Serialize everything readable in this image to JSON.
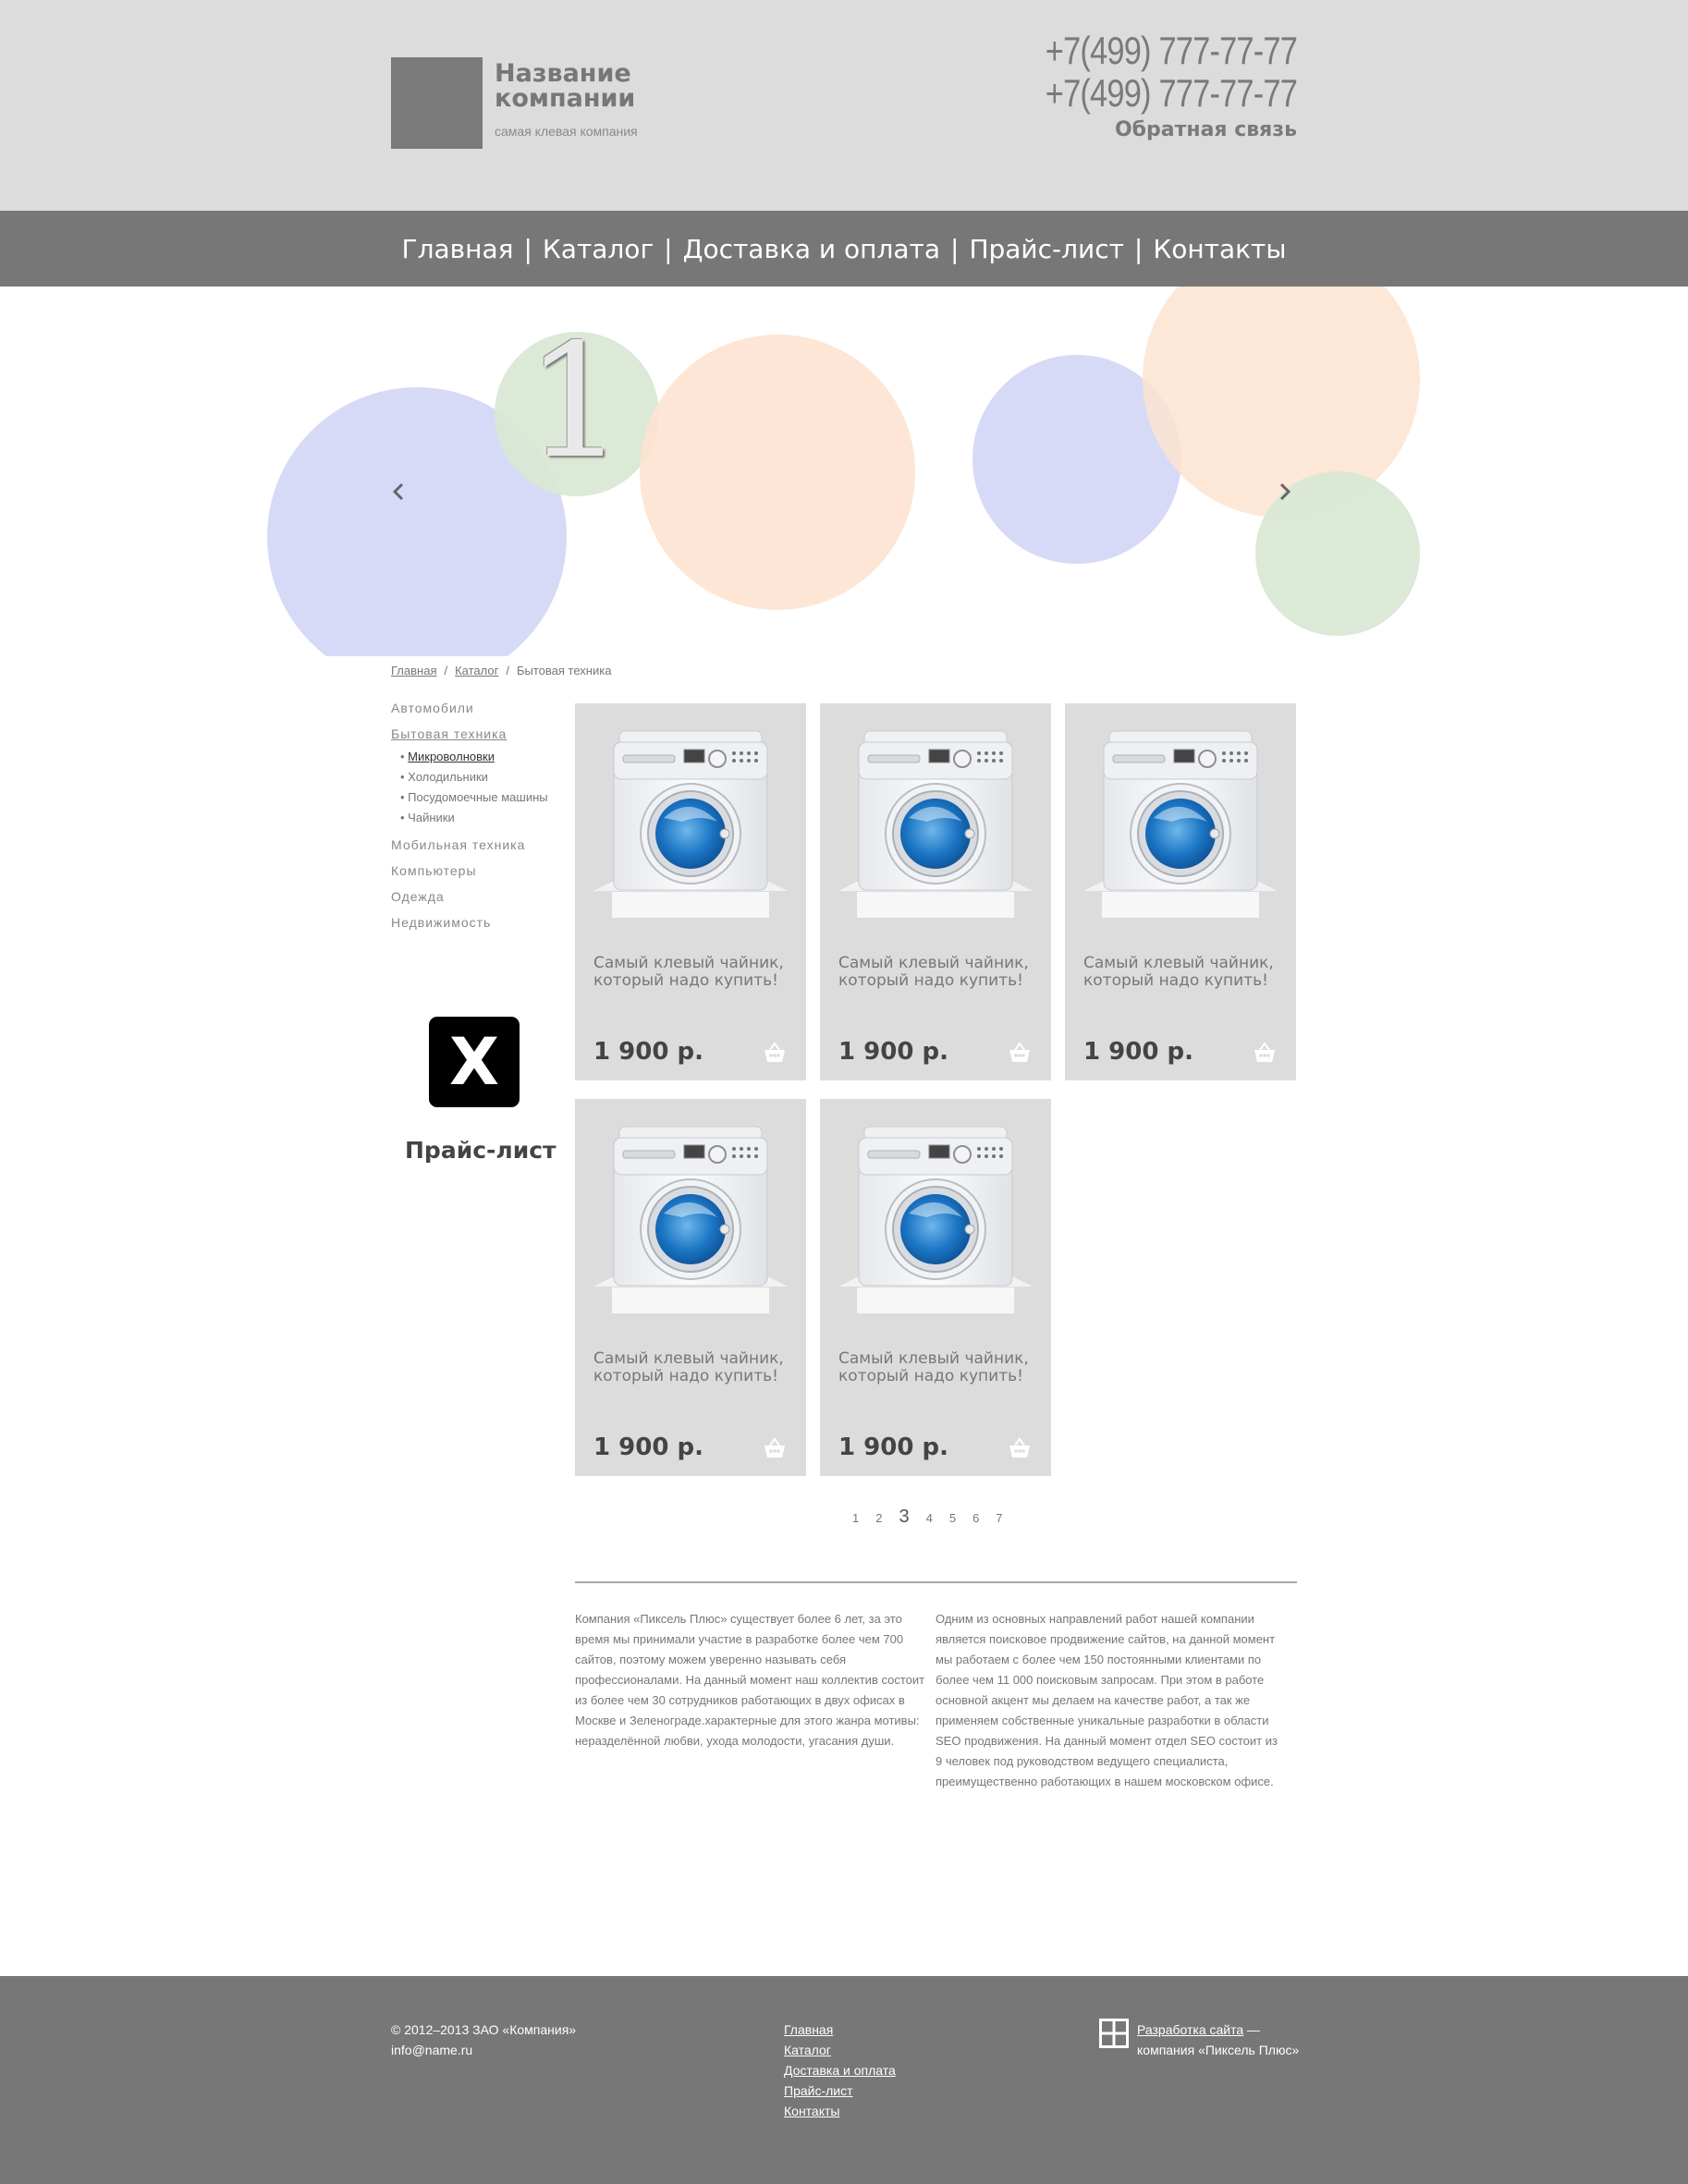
{
  "header": {
    "company_name": "Название компании",
    "tagline": "самая клевая компания",
    "phone1": "+7(499) 777-77-77",
    "phone2": "+7(499) 777-77-77",
    "feedback": "Обратная связь"
  },
  "nav": {
    "items": [
      "Главная",
      "Каталог",
      "Доставка и оплата",
      "Прайс-лист",
      "Контакты"
    ],
    "separator": "|"
  },
  "slider": {
    "slide_number": "1",
    "prev_icon": "chevron-left-icon",
    "next_icon": "chevron-right-icon"
  },
  "breadcrumb": {
    "items": [
      "Главная",
      "Каталог",
      "Бытовая техника"
    ],
    "separator": "/"
  },
  "sidebar": {
    "categories": [
      "Автомобили",
      "Бытовая техника",
      "Мобильная техника",
      "Компьютеры",
      "Одежда",
      "Недвижимость"
    ],
    "subcategories": [
      "Микроволновки",
      "Холодильники",
      "Посудомоечные машины",
      "Чайники"
    ],
    "price_list_icon": "excel-x-icon",
    "price_list_icon_letter": "X",
    "price_list_label": "Прайс-лист"
  },
  "products": [
    {
      "name": "Самый клевый чайник, который надо купить!",
      "price": "1 900 р."
    },
    {
      "name": "Самый клевый чайник, который надо купить!",
      "price": "1 900 р."
    },
    {
      "name": "Самый клевый чайник, который надо купить!",
      "price": "1 900 р."
    },
    {
      "name": "Самый клевый чайник, который надо купить!",
      "price": "1 900 р."
    },
    {
      "name": "Самый клевый чайник, который надо купить!",
      "price": "1 900 р."
    }
  ],
  "pagination": {
    "pages": [
      "1",
      "2",
      "3",
      "4",
      "5",
      "6",
      "7"
    ],
    "current": "3"
  },
  "about": {
    "col1": "Компания «Пиксель Плюс» существует более 6 лет, за это время мы принимали участие в разработке более чем 700 сайтов, поэтому можем уверенно называть себя профессионалами. На данный момент наш коллектив состоит из более чем 30 сотрудников работающих в двух офисах в Москве и Зеленограде.характерные для этого жанра мотивы: неразделённой любви, ухода молодости, угасания души.",
    "col2": "Одним из основных направлений работ нашей компании является поисковое продвижение сайтов, на данной момент мы работаем с более чем 150 постоянными клиентами по более чем 11 000 поисковым запросам. При этом в работе основной акцент мы делаем на качестве работ, а так же применяем собственные уникальные разработки в области SEO продвижения. На данный момент отдел SEO состоит из 9 человек под руководством ведущего специалиста, преимущественно работающих в нашем московском офисе."
  },
  "footer": {
    "copyright": "© 2012–2013 ЗАО «Компания»",
    "email": "info@name.ru",
    "links": [
      "Главная",
      "Каталог",
      "Доставка и оплата",
      "Прайс-лист",
      "Контакты"
    ],
    "dev_link": "Разработка сайта",
    "dev_dash": " —",
    "dev_company": "компания «Пиксель Плюс»"
  },
  "colors": {
    "header_bg": "#dcdcdc",
    "nav_bg": "#777777",
    "card_bg": "#dcdcdc",
    "footer_bg": "#777777",
    "circle_blue": "#d4d8f6",
    "circle_green": "#d9e8d4",
    "circle_peach": "#fde3d0"
  }
}
